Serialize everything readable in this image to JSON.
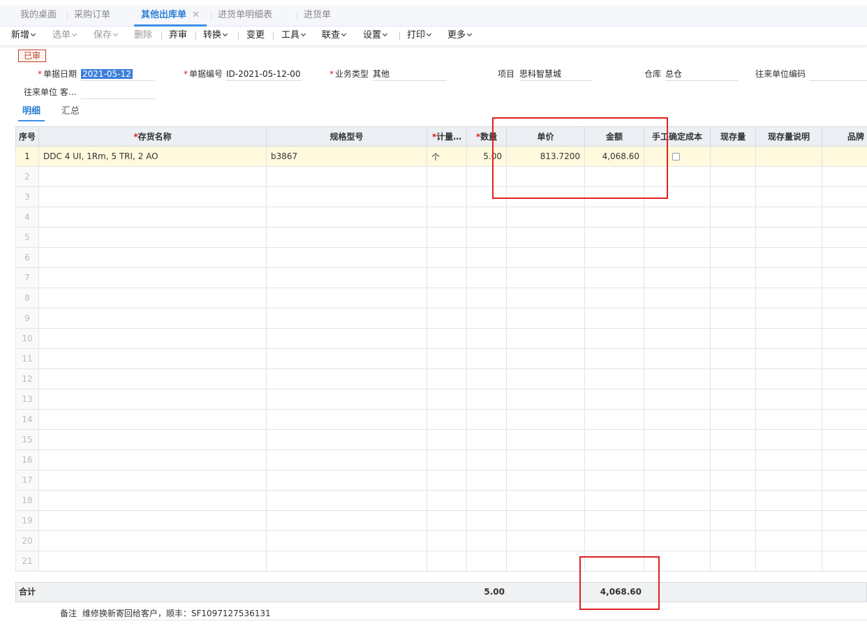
{
  "tabs": [
    {
      "label": "我的桌面"
    },
    {
      "label": "采购订单"
    },
    {
      "label": "其他出库单",
      "active": true
    },
    {
      "label": "进货单明细表"
    },
    {
      "label": "进货单"
    }
  ],
  "tab_close": "✕",
  "toolbar": {
    "new": "新增",
    "select": "选单",
    "save": "保存",
    "delete": "删除",
    "unapprove": "弃审",
    "convert": "转换",
    "change": "变更",
    "tools": "工具",
    "query": "联查",
    "settings": "设置",
    "print": "打印",
    "more": "更多"
  },
  "status_badge": "已审",
  "form": {
    "date_label": "单据日期",
    "date_value": "2021-05-12",
    "code_label": "单据编号",
    "code_value": "ID-2021-05-12-00…",
    "biztype_label": "业务类型",
    "biztype_value": "其他",
    "project_label": "项目",
    "project_value": "思科智慧城",
    "warehouse_label": "仓库",
    "warehouse_value": "总仓",
    "partner_code_label": "往来单位编码",
    "partner_code_value": "",
    "partner_label": "往来单位 客…",
    "partner_value": ""
  },
  "subtabs": {
    "detail": "明细",
    "summary": "汇总"
  },
  "grid": {
    "columns": [
      "序号",
      "存货名称",
      "规格型号",
      "计量…",
      "数量",
      "单价",
      "金额",
      "手工确定成本",
      "现存量",
      "现存量说明",
      "品牌"
    ],
    "rows": [
      {
        "idx": "1",
        "name": "DDC 4 UI, 1Rm, 5 TRI, 2 AO",
        "spec": "b3867",
        "unit": "个",
        "qty": "5.00",
        "price": "813.7200",
        "amount": "4,068.60",
        "manual": "",
        "stock": "",
        "stock_note": "",
        "brand": ""
      }
    ],
    "empty_row_numbers": [
      "2",
      "3",
      "4",
      "5",
      "6",
      "7",
      "8",
      "9",
      "10",
      "11",
      "12",
      "13",
      "14",
      "15",
      "16",
      "17",
      "18",
      "19",
      "20",
      "21"
    ]
  },
  "summary": {
    "label": "合计",
    "qty": "5.00",
    "amount": "4,068.60"
  },
  "remark": {
    "label": "备注",
    "value": "维修换新寄回给客户，顺丰：SF1097127536131"
  },
  "colors": {
    "accent": "#3c8ee6",
    "required": "#e02020",
    "active_row": "#fff9dd",
    "annotation": "#e02020"
  }
}
